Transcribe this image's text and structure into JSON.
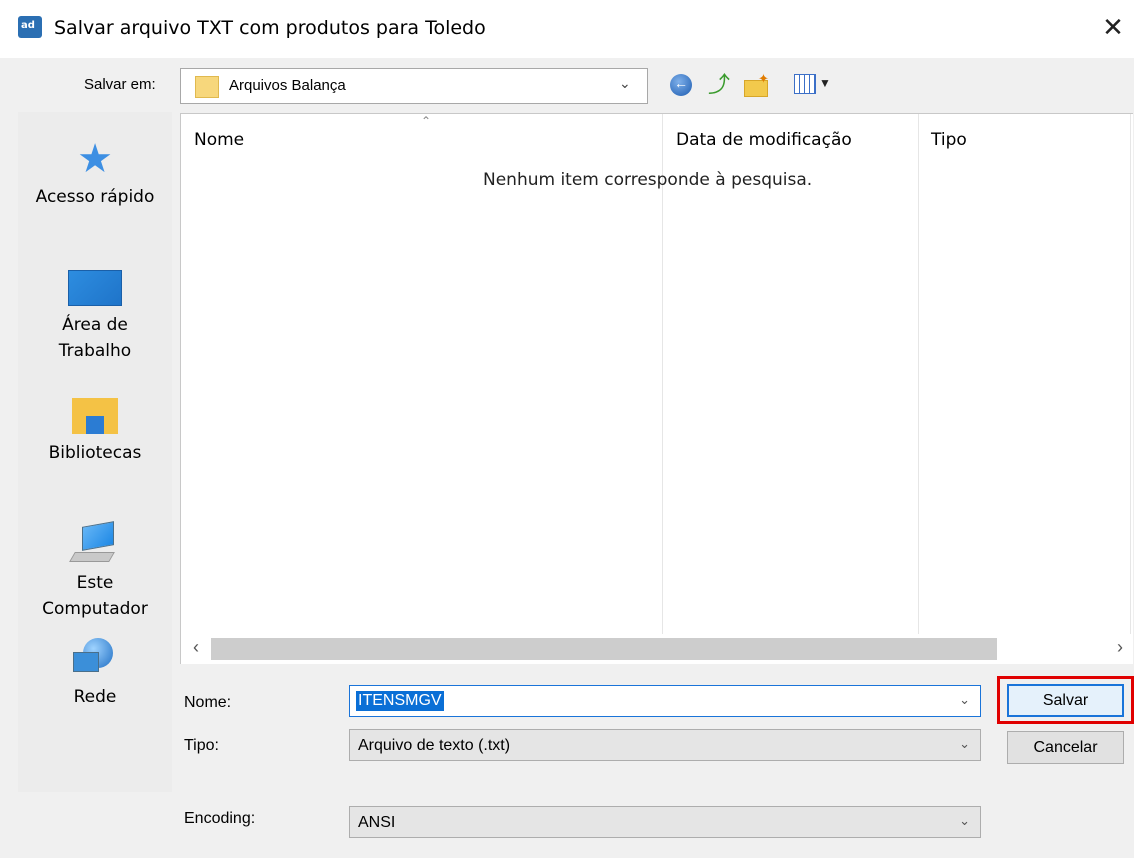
{
  "window": {
    "title": "Salvar arquivo TXT com produtos para Toledo",
    "app_icon_text": "ad",
    "close_symbol": "✕"
  },
  "save_in": {
    "label": "Salvar em:",
    "value": "Arquivos Balança"
  },
  "toolbar_icons": [
    "back-icon",
    "up-folder-icon",
    "new-folder-icon",
    "views-menu-icon"
  ],
  "places": [
    {
      "label": "Acesso rápido",
      "icon": "quick-access-star-icon"
    },
    {
      "label": "Área de\nTrabalho",
      "icon": "desktop-icon"
    },
    {
      "label": "Bibliotecas",
      "icon": "libraries-icon"
    },
    {
      "label": "Este\nComputador",
      "icon": "this-pc-icon"
    },
    {
      "label": "Rede",
      "icon": "network-icon"
    }
  ],
  "file_list": {
    "columns": [
      "Nome",
      "Data de modificação",
      "Tipo"
    ],
    "empty_message": "Nenhum item corresponde à pesquisa."
  },
  "fields": {
    "nome_label": "Nome:",
    "nome_value": "ITENSMGV",
    "tipo_label": "Tipo:",
    "tipo_value": "Arquivo de texto (.txt)",
    "encoding_label": "Encoding:",
    "encoding_value": "ANSI"
  },
  "buttons": {
    "save": "Salvar",
    "cancel": "Cancelar"
  },
  "colors": {
    "highlight_border": "#e00000",
    "selection": "#0a6fd6",
    "focus_border": "#1a74d9"
  }
}
